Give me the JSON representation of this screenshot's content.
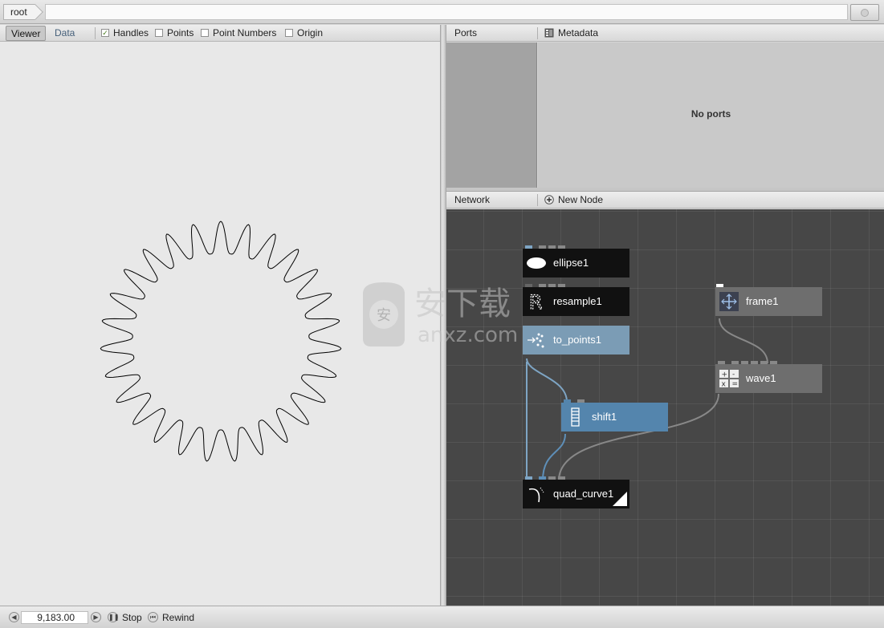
{
  "breadcrumb": {
    "root": "root"
  },
  "viewer": {
    "tabs": [
      "Viewer",
      "Data"
    ],
    "options": [
      {
        "label": "Handles",
        "checked": true
      },
      {
        "label": "Points",
        "checked": false
      },
      {
        "label": "Point Numbers",
        "checked": false
      },
      {
        "label": "Origin",
        "checked": false
      }
    ],
    "shape": {
      "spikes": 27,
      "inner_radius": 110,
      "outer_radius": 150,
      "stroke": "#000000"
    }
  },
  "ports": {
    "title": "Ports",
    "metadata_label": "Metadata",
    "empty_text": "No ports"
  },
  "network": {
    "title": "Network",
    "new_node_label": "New Node",
    "nodes": [
      {
        "id": "ellipse1",
        "label": "ellipse1",
        "color": "#111111",
        "icon": "ellipse-icon"
      },
      {
        "id": "resample1",
        "label": "resample1",
        "color": "#111111",
        "icon": "resample-icon"
      },
      {
        "id": "to_points1",
        "label": "to_points1",
        "color": "#7b9cb5",
        "icon": "to-points-icon"
      },
      {
        "id": "shift1",
        "label": "shift1",
        "color": "#5485ad",
        "icon": "shift-icon"
      },
      {
        "id": "quad_curve1",
        "label": "quad_curve1",
        "color": "#111111",
        "icon": "quad-curve-icon"
      },
      {
        "id": "frame1",
        "label": "frame1",
        "color": "#6e6e6e",
        "icon": "frame-icon"
      },
      {
        "id": "wave1",
        "label": "wave1",
        "color": "#6e6e6e",
        "icon": "wave-icon"
      }
    ]
  },
  "playback": {
    "frame": "9,183.00",
    "stop_label": "Stop",
    "rewind_label": "Rewind"
  },
  "watermark": {
    "text_cn": "安下载",
    "text_en": "anxz.com",
    "badge": "安"
  }
}
